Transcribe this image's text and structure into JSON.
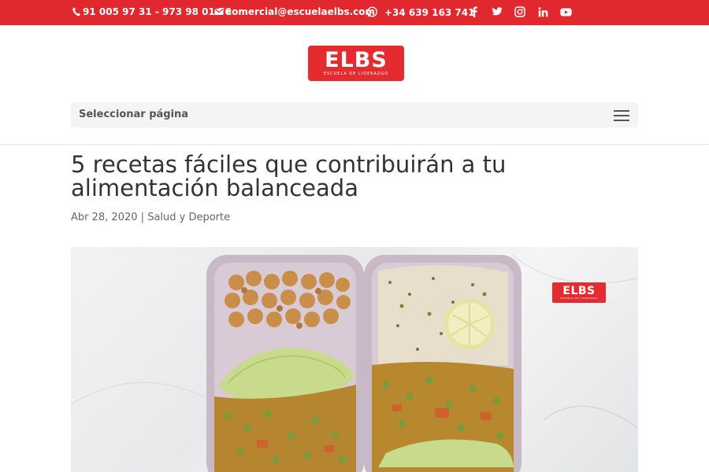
{
  "topbar": {
    "phone": "91 005 97 31 - 973 98 01 76",
    "email": "comercial@escuelaelbs.com",
    "whatsapp": "+34 639 163 741"
  },
  "logo": {
    "brand": "ELBS",
    "tagline": "ESCUELA DE LIDERAZGO"
  },
  "nav": {
    "select_label": "Seleccionar página"
  },
  "post": {
    "title": "5 recetas fáciles que contribuirán a tu alimentación balanceada",
    "date": "Abr 28, 2020",
    "separator": "|",
    "category": "Salud y Deporte"
  },
  "hero": {
    "logo_brand": "ELBS",
    "logo_tagline": "ESCUELA DE LIDERAZGO"
  },
  "colors": {
    "accent": "#e0282e",
    "text": "#333333",
    "meta": "#666666",
    "nav_bg": "#f4f4f4"
  }
}
